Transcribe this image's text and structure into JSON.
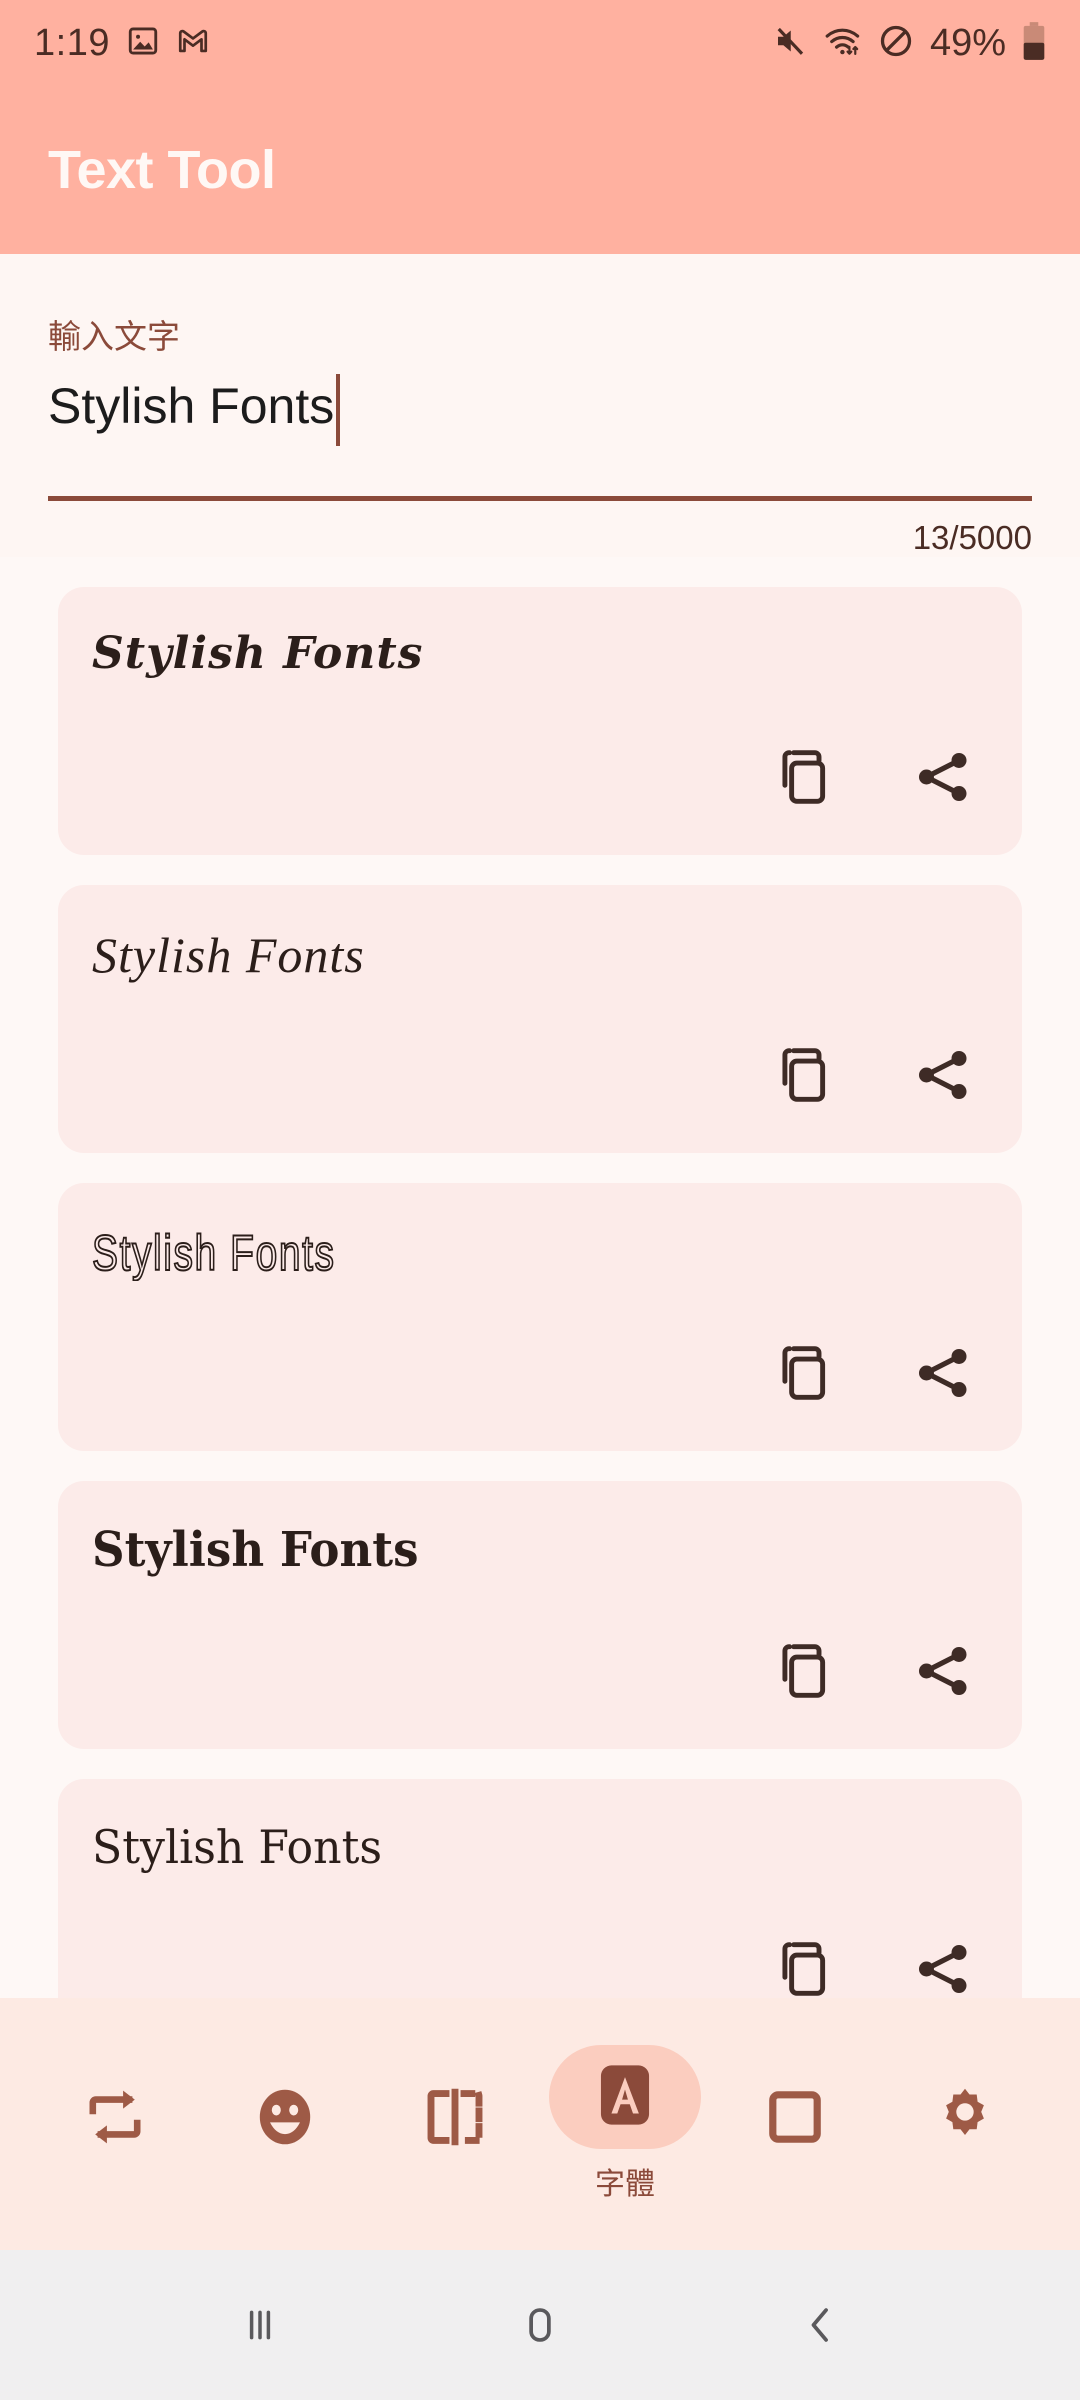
{
  "status_bar": {
    "time": "1:19",
    "battery_percent": "49%",
    "icons": [
      "photos-icon",
      "gmail-icon",
      "mute-icon",
      "wifi-icon",
      "dnd-icon",
      "battery-icon"
    ]
  },
  "app_bar": {
    "title": "Text Tool"
  },
  "input": {
    "label": "輸入文字",
    "value": "Stylish Fonts",
    "counter": "13/5000",
    "placeholder": "輸入文字"
  },
  "cards": [
    {
      "sample": "Stylish Fonts",
      "style": "sample-script",
      "copy_label": "copy-icon",
      "share_label": "share-icon"
    },
    {
      "sample": "Stylish Fonts",
      "style": "sample-script2",
      "copy_label": "copy-icon",
      "share_label": "share-icon"
    },
    {
      "sample": "Stylish Fonts",
      "style": "sample-deco",
      "copy_label": "copy-icon",
      "share_label": "share-icon"
    },
    {
      "sample": "Stylish Fonts",
      "style": "sample-goth",
      "copy_label": "copy-icon",
      "share_label": "share-icon"
    },
    {
      "sample": "Stylish Fonts",
      "style": "sample-goth2",
      "copy_label": "copy-icon",
      "share_label": "share-icon"
    }
  ],
  "toolbar": {
    "items": [
      {
        "icon": "repeat-swap-icon",
        "label": "",
        "selected": false
      },
      {
        "icon": "emoji-icon",
        "label": "",
        "selected": false
      },
      {
        "icon": "mirror-flip-icon",
        "label": "",
        "selected": false
      },
      {
        "icon": "font-a-icon",
        "label": "字體",
        "selected": true
      },
      {
        "icon": "frame-square-icon",
        "label": "",
        "selected": false
      },
      {
        "icon": "settings-gear-icon",
        "label": "",
        "selected": false
      }
    ]
  },
  "nav_bar": {
    "recents_label": "recents-icon",
    "home_label": "home-icon",
    "back_label": "back-icon"
  },
  "colors": {
    "app_bar": "#FFB1A0",
    "page_bg": "#FEF8F6",
    "card_bg": "#FCEBE9",
    "toolbar_bg": "#FDEAE3",
    "accent_brown": "#8B4A3A",
    "icon_brown": "#9E5A46",
    "text_dark": "#2B1E1A",
    "nav_bg": "#F0EFF0",
    "selected_pill": "#FBCDBF"
  }
}
